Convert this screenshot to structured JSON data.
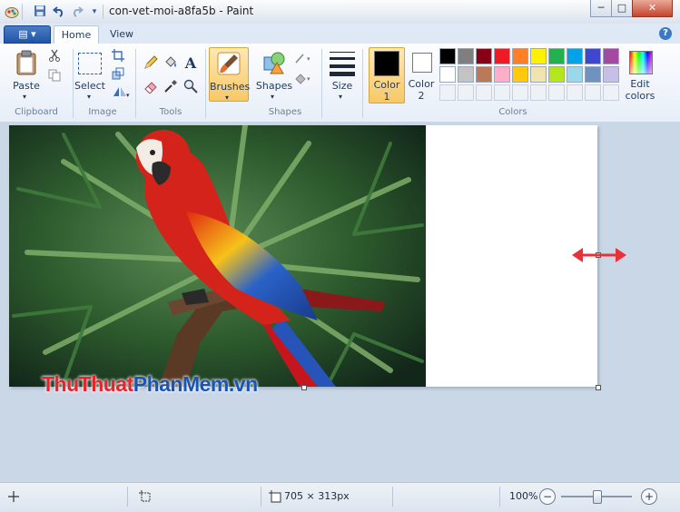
{
  "window": {
    "title": "con-vet-moi-a8fa5b - Paint",
    "controls": [
      "─",
      "□",
      "✕"
    ]
  },
  "tabs": {
    "menu_label": "▤ ▾",
    "home": "Home",
    "view": "View",
    "help": "?"
  },
  "ribbon": {
    "clipboard": {
      "paste": "Paste",
      "group": "Clipboard"
    },
    "image": {
      "select": "Select",
      "group": "Image"
    },
    "tools": {
      "group": "Tools",
      "text_tool": "A"
    },
    "brushes": {
      "label": "Brushes"
    },
    "shapes": {
      "label": "Shapes",
      "group": "Shapes"
    },
    "size": {
      "label": "Size"
    },
    "colors": {
      "color1_a": "Color",
      "color1_b": "1",
      "color2_a": "Color",
      "color2_b": "2",
      "edit_a": "Edit",
      "edit_b": "colors",
      "group": "Colors",
      "color1": "#000000",
      "color2": "#ffffff",
      "palette": [
        "#000000",
        "#7f7f7f",
        "#880015",
        "#ed1c24",
        "#ff7f27",
        "#fff200",
        "#22b14c",
        "#00a2e8",
        "#3f48cc",
        "#a349a4",
        "#ffffff",
        "#c3c3c3",
        "#b97a57",
        "#ffaec9",
        "#ffc90e",
        "#efe4b0",
        "#b5e61d",
        "#99d9ea",
        "#7092be",
        "#c8bfe7"
      ]
    }
  },
  "canvas": {
    "watermark_a": "ThuThuat",
    "watermark_b": "PhanMem",
    "watermark_c": ".vn",
    "resize_arrow": "⟷"
  },
  "status": {
    "size": "705 × 313px",
    "zoom": "100%",
    "zoom_level": 0.5
  }
}
